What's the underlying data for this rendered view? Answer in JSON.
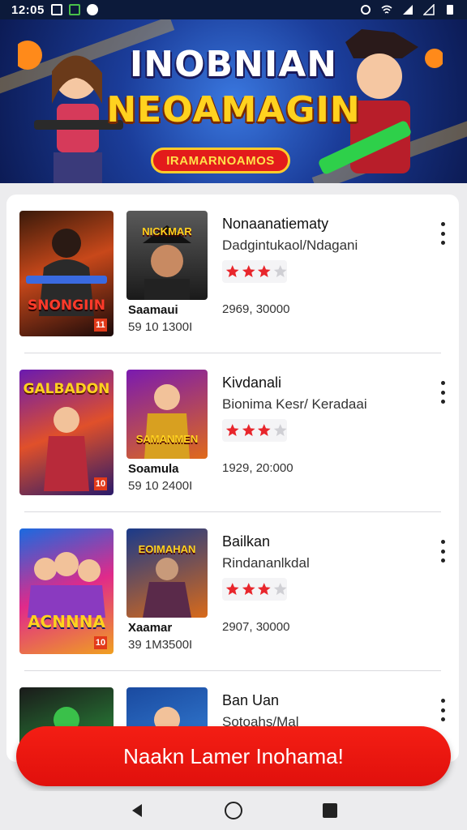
{
  "status_bar": {
    "time": "12:05",
    "icons": [
      "image-icon",
      "photo-icon",
      "notification-icon",
      "alarm-icon",
      "wifi-icon",
      "signal-icon",
      "signal-2-icon",
      "battery-icon"
    ]
  },
  "banner": {
    "title_line1": "INOBNIAN",
    "title_line2": "NEOAMAGIN",
    "pill_label": "IRAMARNOAMOS",
    "colors": {
      "title2": "#ffd21f",
      "pill": "#e31b1b",
      "pill_border": "#ffcc2a"
    }
  },
  "items": [
    {
      "cover_text": "SNONGIIN",
      "age_badge": "11",
      "thumb_text": "NICKMAR",
      "under_title": "Saamaui",
      "under_code": "59 10 1300I",
      "name": "Nonaanatiematy",
      "subtitle": "Dadgintukaol/Ndagani",
      "rating": 3,
      "meta": "2969, 30000"
    },
    {
      "cover_text": "GALBADON",
      "age_badge": "10",
      "thumb_text": "SAMANMEN",
      "under_title": "Soamula",
      "under_code": "59 10 2400I",
      "name": "Kivdanali",
      "subtitle": "Bionima Kesr/ Keradaai",
      "rating": 3,
      "meta": "1929, 20:000"
    },
    {
      "cover_text": "ACNNNA",
      "age_badge": "10",
      "thumb_text": "EOIMAHAN",
      "under_title": "Xaamar",
      "under_code": "39 1M3500I",
      "name": "Bailkan",
      "subtitle": "Rindananlkdal",
      "rating": 3,
      "meta": "2907, 30000"
    },
    {
      "cover_text": "",
      "age_badge": "",
      "thumb_text": "",
      "under_title": "",
      "under_code": "",
      "name": "Ban Uan",
      "subtitle": "Sotoahs/Mal",
      "rating": 0,
      "meta": ""
    }
  ],
  "cta": {
    "label": "Naakn Lamer Inohama!",
    "color": "#f41e14"
  },
  "nav": {
    "back": "back-icon",
    "home": "home-icon",
    "recents": "recents-icon"
  }
}
